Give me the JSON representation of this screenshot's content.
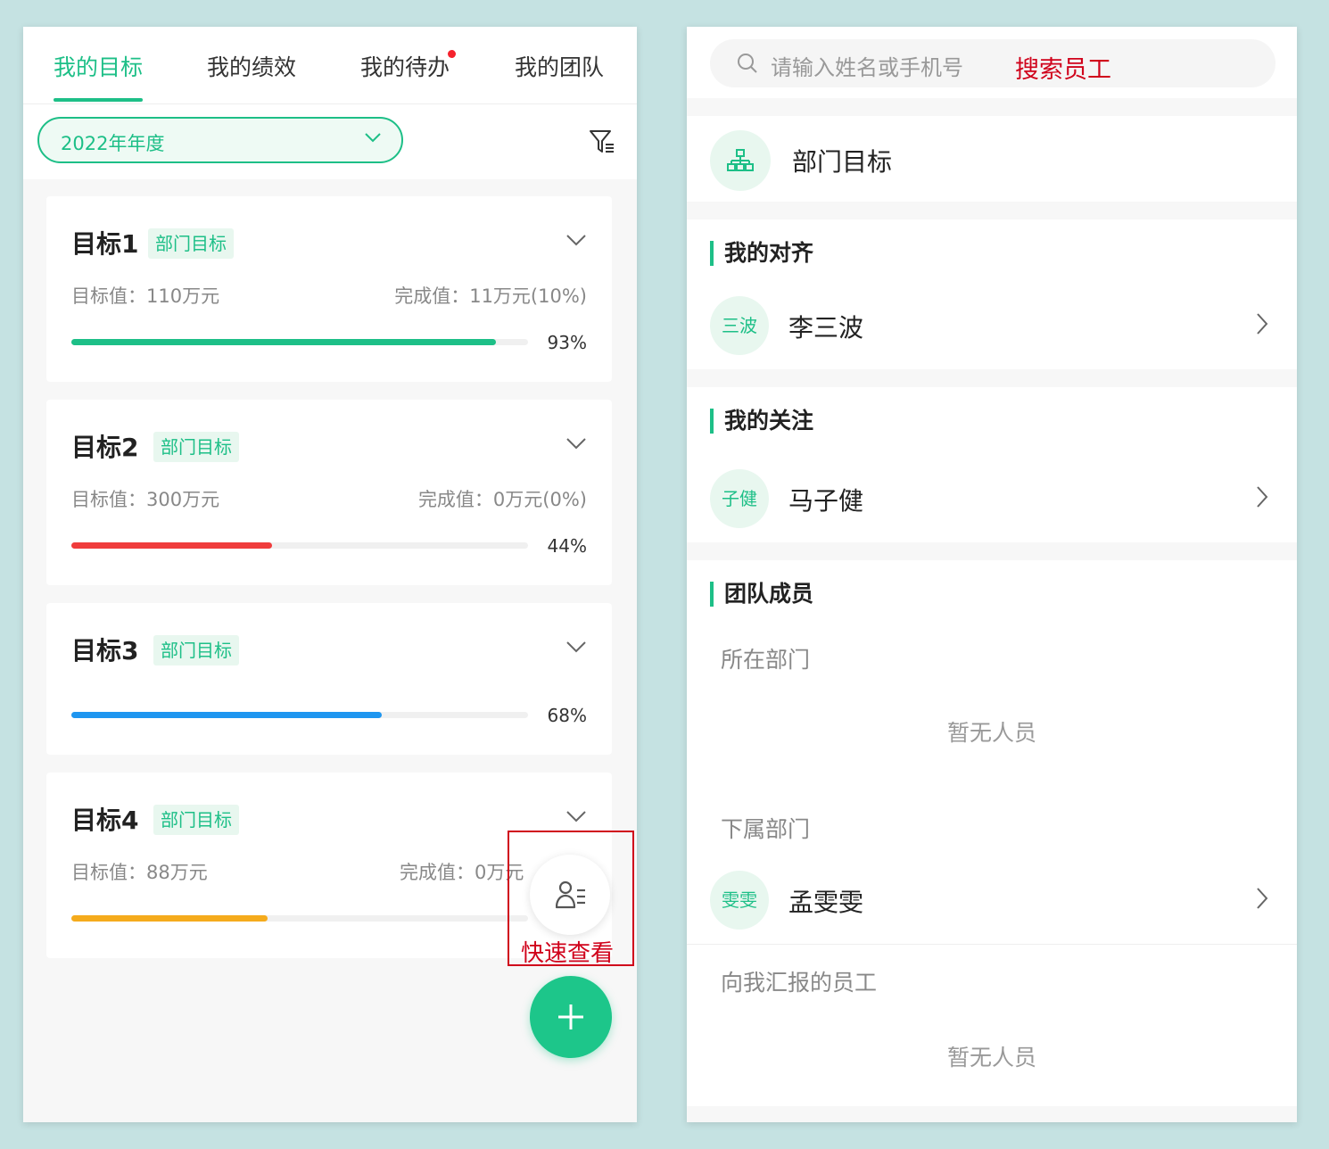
{
  "left": {
    "tabs": [
      {
        "label": "我的目标"
      },
      {
        "label": "我的绩效"
      },
      {
        "label": "我的待办"
      },
      {
        "label": "我的团队"
      }
    ],
    "year_select": "2022年年度",
    "goals": [
      {
        "title": "目标1",
        "tag": "部门目标",
        "target": "目标值：110万元",
        "done": "完成值：11万元(10%)",
        "percent": "93%",
        "progress": 0.93,
        "color": "#1dbf87"
      },
      {
        "title": "目标2",
        "tag": "部门目标",
        "target": "目标值：300万元",
        "done": "完成值：0万元(0%)",
        "percent": "44%",
        "progress": 0.44,
        "color": "#f03c3c"
      },
      {
        "title": "目标3",
        "tag": "部门目标",
        "target": "",
        "done": "",
        "percent": "68%",
        "progress": 0.68,
        "color": "#1e96f0"
      },
      {
        "title": "目标4",
        "tag": "部门目标",
        "target": "目标值：88万元",
        "done": "完成值：0万元",
        "percent": "",
        "progress": 0.43,
        "color": "#f5ab1c"
      }
    ],
    "quick_view_label": "快速查看"
  },
  "right": {
    "search": {
      "placeholder": "请输入姓名或手机号",
      "annotation": "搜索员工"
    },
    "dept_goal": "部门目标",
    "alignment": {
      "heading": "我的对齐",
      "person": {
        "avatar": "三波",
        "name": "李三波"
      }
    },
    "follow": {
      "heading": "我的关注",
      "person": {
        "avatar": "子健",
        "name": "马子健"
      }
    },
    "team": {
      "heading": "团队成员",
      "current_dept": "所在部门",
      "current_dept_empty": "暂无人员",
      "sub_dept": "下属部门",
      "sub_person": {
        "avatar": "雯雯",
        "name": "孟雯雯"
      },
      "reports": "向我汇报的员工",
      "reports_empty": "暂无人员"
    }
  },
  "colors": {
    "accent": "#1dbf87",
    "annotation": "#d0021b"
  }
}
